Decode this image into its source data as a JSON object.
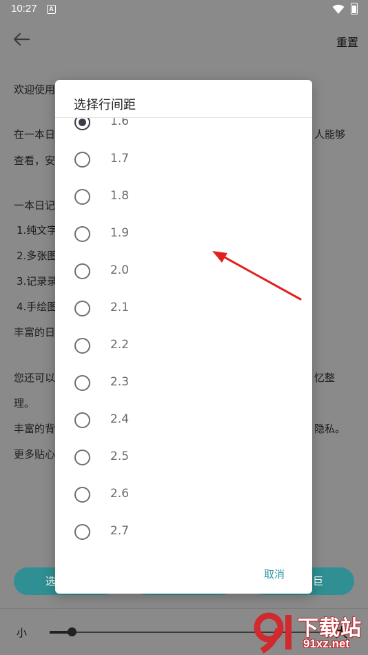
{
  "status_bar": {
    "time": "10:27",
    "notification_letter": "A"
  },
  "app_bar": {
    "reset_label": "重置"
  },
  "background": {
    "lines": [
      {
        "text": "欢迎使用",
        "top": 0
      },
      {
        "text": "在一本日",
        "top": 0
      },
      {
        "text": "查看，安",
        "top": 0
      },
      {
        "text": "一本日记",
        "top": 0
      },
      {
        "text": "1.纯文字",
        "top": 0
      },
      {
        "text": "2.多张图",
        "top": 0
      },
      {
        "text": "3.记录录",
        "top": 0
      },
      {
        "text": "4.手绘图",
        "top": 0
      },
      {
        "text": "丰富的日",
        "top": 0
      },
      {
        "text": "您还可以",
        "top": 0
      },
      {
        "text": "理。",
        "top": 0
      },
      {
        "text": "丰富的背",
        "top": 0
      },
      {
        "text": "更多贴心",
        "top": 0
      }
    ],
    "right_fragments": [
      "人能够",
      "忆整",
      "隐私。"
    ],
    "bottom_buttons": [
      "选",
      "",
      "巨"
    ],
    "slider": {
      "small_label": "小",
      "large_label": "大",
      "value": 0.08
    }
  },
  "dialog": {
    "title": "选择行间距",
    "selected": "1.6",
    "options": [
      "1.6",
      "1.7",
      "1.8",
      "1.9",
      "2.0",
      "2.1",
      "2.2",
      "2.3",
      "2.4",
      "2.5",
      "2.6",
      "2.7"
    ],
    "cancel_label": "取消"
  },
  "watermark": {
    "brand": "下载站",
    "domain": "91xz.net"
  },
  "colors": {
    "accent": "#2f9aa0",
    "button": "#2f8f92",
    "arrow": "#e0211f"
  }
}
